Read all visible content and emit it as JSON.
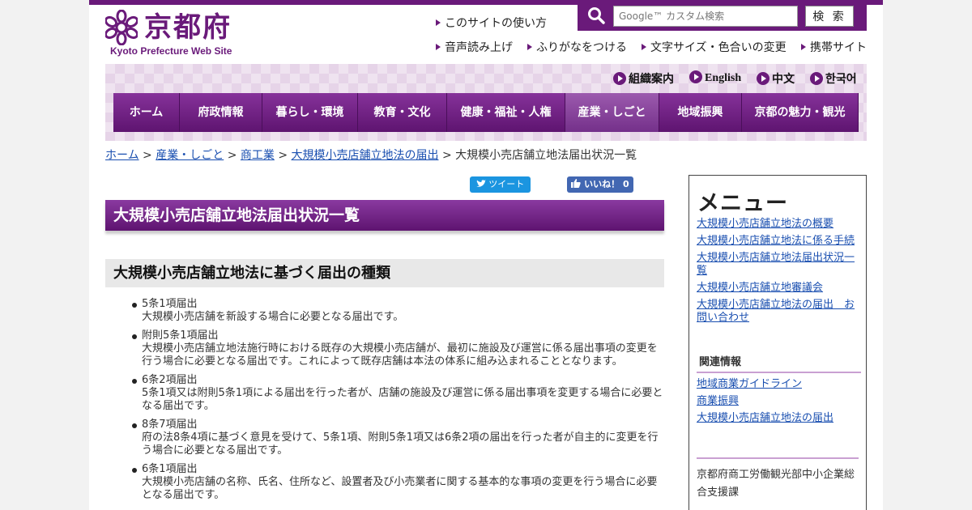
{
  "header": {
    "logo_name": "京都府",
    "logo_sub": "Kyoto Prefecture Web Site",
    "site_usage": "このサイトの使い方",
    "utility": [
      "音声読み上げ",
      "ふりがなをつける",
      "文字サイズ・色合いの変更",
      "携帯サイト"
    ],
    "search_placeholder": "Google™ カスタム検索",
    "search_button": "検 索"
  },
  "languages": [
    "組織案内",
    "English",
    "中文",
    "한국어"
  ],
  "global_nav": [
    {
      "label": "ホーム",
      "active": false
    },
    {
      "label": "府政情報",
      "active": false
    },
    {
      "label": "暮らし・環境",
      "active": false
    },
    {
      "label": "教育・文化",
      "active": false
    },
    {
      "label": "健康・福祉・人権",
      "active": false
    },
    {
      "label": "産業・しごと",
      "active": true
    },
    {
      "label": "地域振興",
      "active": false
    },
    {
      "label": "京都の魅力・観光",
      "active": false
    }
  ],
  "breadcrumb": {
    "links": [
      "ホーム",
      "産業・しごと",
      "商工業",
      "大規模小売店舗立地法の届出"
    ],
    "separator": ">",
    "current": "大規模小売店舗立地法届出状況一覧"
  },
  "social": {
    "tweet": "ツイート",
    "like": "いいね！ 0"
  },
  "main": {
    "title": "大規模小売店舗立地法届出状況一覧",
    "section_title": "大規模小売店舗立地法に基づく届出の種類",
    "items": [
      {
        "head": "5条1項届出",
        "body": "大規模小売店舗を新設する場合に必要となる届出です。"
      },
      {
        "head": "附則5条1項届出",
        "body": "大規模小売店舗立地法施行時における既存の大規模小売店舗が、最初に施設及び運営に係る届出事項の変更を行う場合に必要となる届出です。これによって既存店舗は本法の体系に組み込まれることとなります。"
      },
      {
        "head": "6条2項届出",
        "body": "5条1項又は附則5条1項による届出を行った者が、店舗の施設及び運営に係る届出事項を変更する場合に必要となる届出です。"
      },
      {
        "head": "8条7項届出",
        "body": "府の法8条4項に基づく意見を受けて、5条1項、附則5条1項又は6条2項の届出を行った者が自主的に変更を行う場合に必要となる届出です。"
      },
      {
        "head": "6条1項届出",
        "body": "大規模小売店舗の名称、氏名、住所など、設置者及び小売業者に関する基本的な事項の変更を行う場合に必要となる届出です。"
      }
    ]
  },
  "sidebar": {
    "menu_title": "メニュー",
    "menu_links": [
      "大規模小売店舗立地法の概要",
      "大規模小売店舗立地法に係る手続",
      "大規模小売店舗立地法届出状況一覧",
      "大規模小売店舗立地審議会",
      "大規模小売店舗立地法の届出　お問い合わせ"
    ],
    "related_title": "関連情報",
    "related_links": [
      "地域商業ガイドライン",
      "商業振興",
      "大規模小売店舗立地法の届出"
    ],
    "department": "京都府商工労働観光部中小企業総合支援課"
  },
  "colors": {
    "brand": "#6a1a7a",
    "link": "#1a4fb0",
    "tweet": "#1b95e0",
    "like": "#4267b2"
  }
}
